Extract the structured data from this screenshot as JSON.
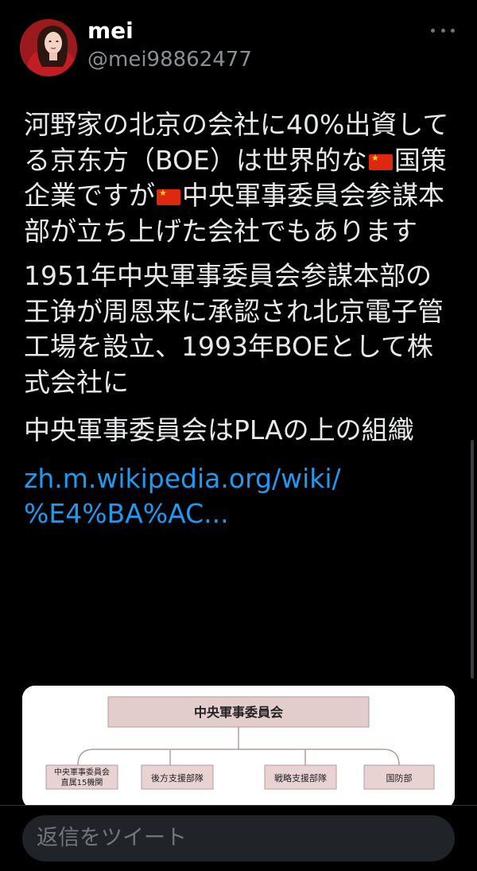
{
  "author": {
    "display_name": "mei",
    "handle": "@mei98862477",
    "avatar_icon": "avatar-photo"
  },
  "tweet": {
    "para1_a": "河野家の北京の会社に40%出資してる京东方（BOE）は世界的な",
    "para1_b": "国策企業ですが",
    "para1_c": "中央軍事委員会参謀本部が立ち上げた会社でもあります",
    "para2": "1951年中央軍事委員会参謀本部の王诤が周恩来に承認され北京電子管工場を設立、1993年BOEとして株式会社に",
    "para3": "中央軍事委員会はPLAの上の組織",
    "link_line1": "zh.m.wikipedia.org/wiki/",
    "link_line2": "%E4%BA%AC...",
    "flag_icon": "china-flag-emoji"
  },
  "media": {
    "top_box": "中央軍事委員会",
    "boxes": [
      "中央軍事委員会\n直属15機関",
      "後方支援部隊",
      "戦略支援部隊",
      "国防部"
    ]
  },
  "reply": {
    "placeholder": "返信をツイート"
  },
  "colors": {
    "background": "#000000",
    "text": "#e7e9ea",
    "link": "#1d9bf0",
    "chart_box": "#e6cfcf"
  }
}
